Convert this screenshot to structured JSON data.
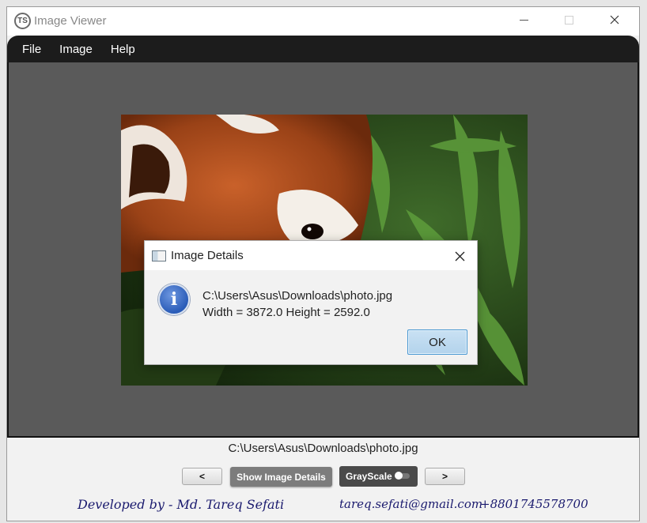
{
  "window": {
    "title": "Image Viewer",
    "icon_text": "TS"
  },
  "menu": [
    "File",
    "Image",
    "Help"
  ],
  "dialog": {
    "title": "Image Details",
    "path": "C:\\Users\\Asus\\Downloads\\photo.jpg",
    "dimensions": "Width = 3872.0 Height = 2592.0",
    "ok_label": "OK"
  },
  "status": {
    "path": "C:\\Users\\Asus\\Downloads\\photo.jpg"
  },
  "controls": {
    "prev_label": "<",
    "details_label": "Show Image Details",
    "grayscale_label": "GrayScale",
    "grayscale_on": false,
    "next_label": ">"
  },
  "footer": {
    "developer": "Developed by - Md. Tareq Sefati",
    "email": "tareq.sefati@gmail.com",
    "phone": "+8801745578700"
  },
  "image": {
    "subject": "red panda among bamboo leaves"
  }
}
